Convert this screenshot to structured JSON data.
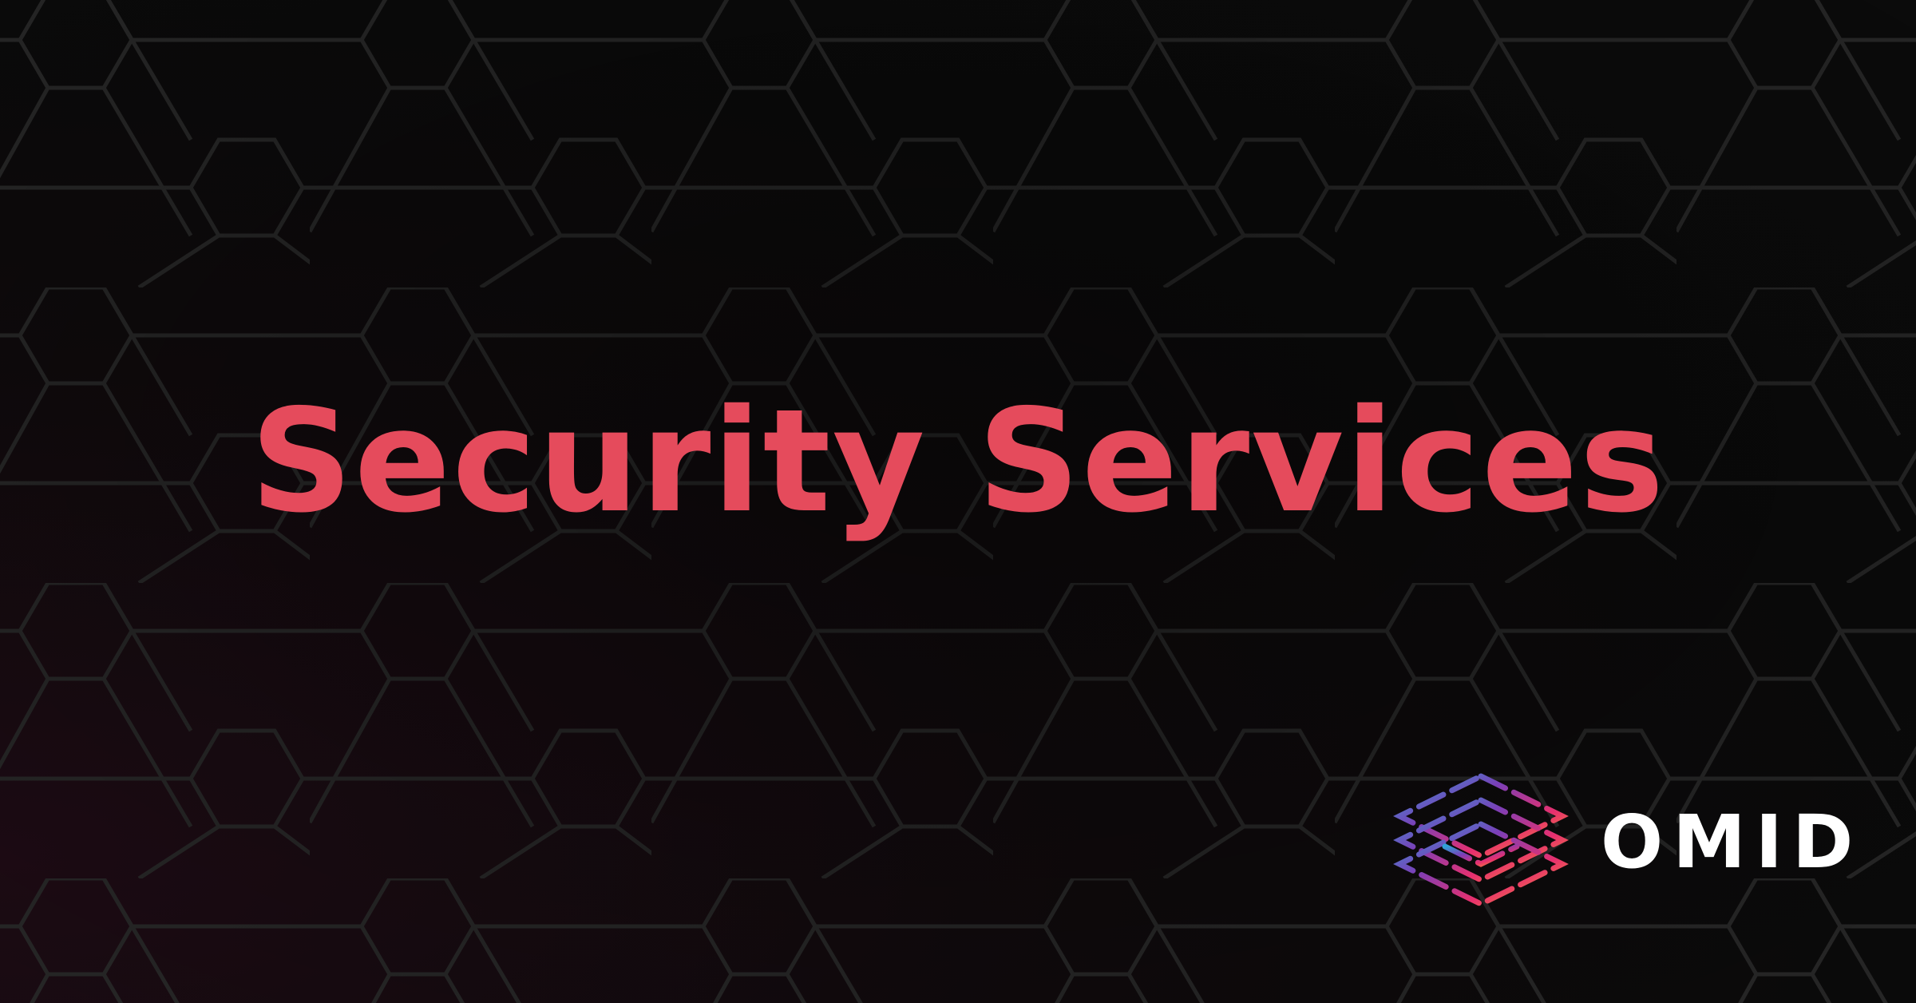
{
  "headline": {
    "text": "Security Services"
  },
  "logo": {
    "icon": "layered-stack-logo-icon",
    "text": "OMID"
  },
  "colors": {
    "headline": "#e54b5c",
    "logo_text": "#ffffff",
    "background": "#0b0809",
    "pattern_line": "#2a2a2a",
    "logo_gradient": [
      "#2fa3d6",
      "#7a3fb8",
      "#e8306e",
      "#f5a623"
    ]
  }
}
